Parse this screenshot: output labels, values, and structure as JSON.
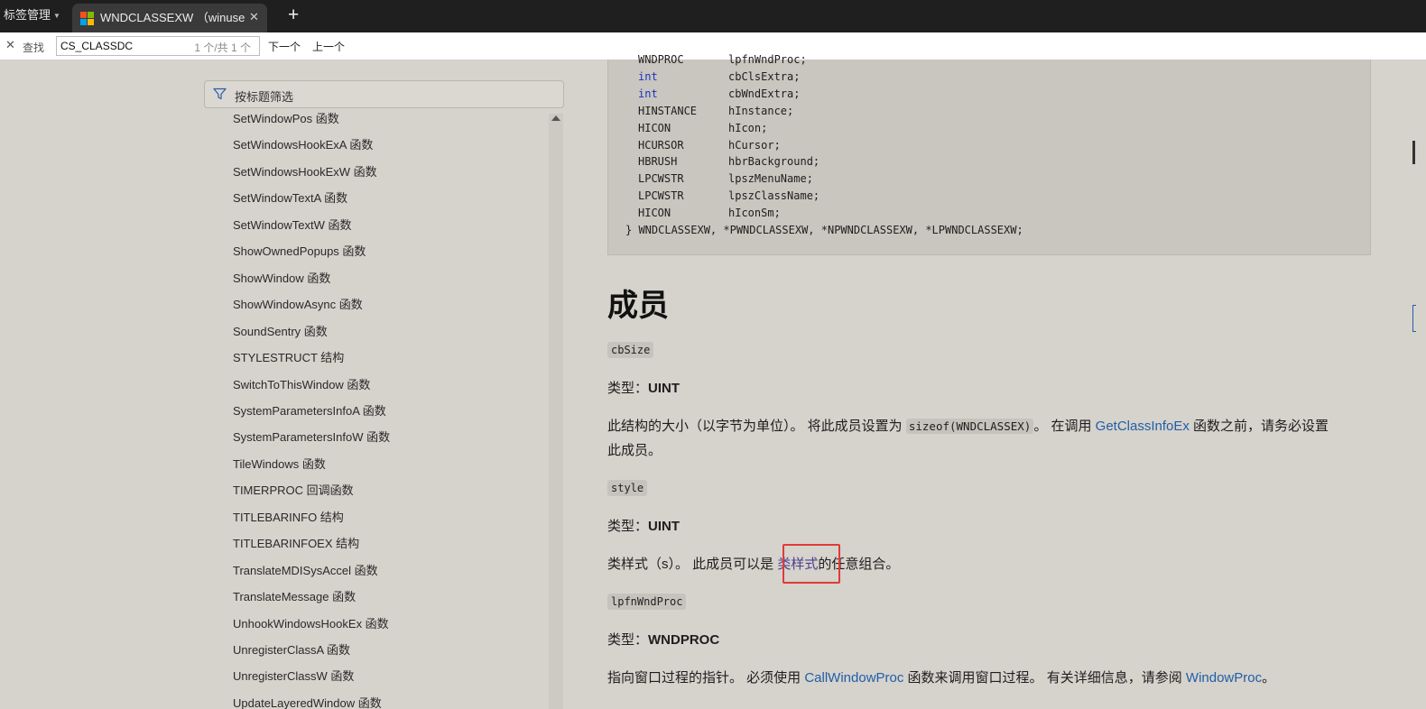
{
  "tabbar": {
    "tab_manager": "标签管理",
    "active_tab_title": "WNDCLASSEXW （winuser.h）",
    "new_tab": "+",
    "close": "✕"
  },
  "find": {
    "close": "✕",
    "label": "查找",
    "query": "CS_CLASSDC",
    "count": "1 个/共 1 个",
    "next": "下一个",
    "prev": "上一个"
  },
  "sidebar": {
    "filter_placeholder": "按标题筛选",
    "items": [
      "SetWindowPos 函数",
      "SetWindowsHookExA 函数",
      "SetWindowsHookExW 函数",
      "SetWindowTextA 函数",
      "SetWindowTextW 函数",
      "ShowOwnedPopups 函数",
      "ShowWindow 函数",
      "ShowWindowAsync 函数",
      "SoundSentry 函数",
      "STYLESTRUCT 结构",
      "SwitchToThisWindow 函数",
      "SystemParametersInfoA 函数",
      "SystemParametersInfoW 函数",
      "TileWindows 函数",
      "TIMERPROC 回调函数",
      "TITLEBARINFO 结构",
      "TITLEBARINFOEX 结构",
      "TranslateMDISysAccel 函数",
      "TranslateMessage 函数",
      "UnhookWindowsHookEx 函数",
      "UnregisterClassA 函数",
      "UnregisterClassW 函数",
      "UpdateLayeredWindow 函数"
    ]
  },
  "code": {
    "lines": [
      {
        "type": "WNDPROC",
        "name": "lpfnWndProc;"
      },
      {
        "type": "int",
        "name": "cbClsExtra;"
      },
      {
        "type": "int",
        "name": "cbWndExtra;"
      },
      {
        "type": "HINSTANCE",
        "name": "hInstance;"
      },
      {
        "type": "HICON",
        "name": "hIcon;"
      },
      {
        "type": "HCURSOR",
        "name": "hCursor;"
      },
      {
        "type": "HBRUSH",
        "name": "hbrBackground;"
      },
      {
        "type": "LPCWSTR",
        "name": "lpszMenuName;"
      },
      {
        "type": "LPCWSTR",
        "name": "lpszClassName;"
      },
      {
        "type": "HICON",
        "name": "hIconSm;"
      }
    ],
    "closing": "} WNDCLASSEXW, *PWNDCLASSEXW, *NPWNDCLASSEXW, *LPWNDCLASSEXW;"
  },
  "content": {
    "heading": "成员",
    "member1": {
      "name": "cbSize",
      "type_prefix": "类型：",
      "type": "UINT",
      "desc_1": "此结构的大小（以字节为单位）。 将此成员设置为 ",
      "desc_code": "sizeof(WNDCLASSEX)",
      "desc_2": "。 在调用 ",
      "desc_link": "GetClassInfoEx",
      "desc_3": " 函数之前，请务必设置",
      "desc_line2": "此成员。"
    },
    "member2": {
      "name": "style",
      "type_prefix": "类型：",
      "type": "UINT",
      "desc_1": "类样式（s）。 此成员可以是 ",
      "desc_link": "类样式",
      "desc_2": "的任意组合。"
    },
    "member3": {
      "name": "lpfnWndProc",
      "type_prefix": "类型：",
      "type": "WNDPROC",
      "desc_1": "指向窗口过程的指针。 必须使用 ",
      "desc_link1": "CallWindowProc",
      "desc_2": " 函数来调用窗口过程。 有关详细信息，请参阅 ",
      "desc_link2": "WindowProc",
      "desc_3": "。"
    }
  },
  "colors": {
    "page_bg": "#d6d2cc",
    "link": "#1f5fa8",
    "keyword": "#1b33c4",
    "highlight": "#e13a3a"
  }
}
